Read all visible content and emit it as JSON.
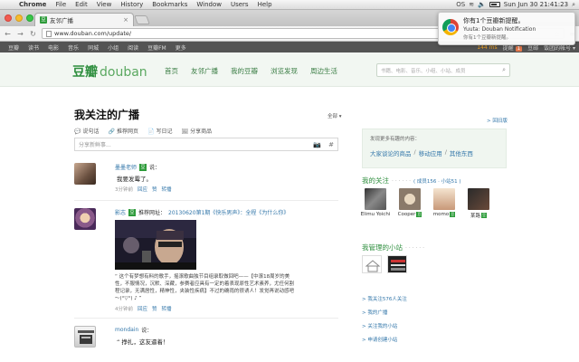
{
  "os_menubar": {
    "app": "Chrome",
    "items": [
      "File",
      "Edit",
      "View",
      "History",
      "Bookmarks",
      "Window",
      "Users",
      "Help"
    ],
    "tray": [
      "OS"
    ],
    "clock": "Sun Jun 30  21:41:23"
  },
  "browser": {
    "tab_title": "友邻广播",
    "tab_favicon": "豆",
    "url": "www.douban.com/update/"
  },
  "notification": {
    "title": "你有1个豆瓣新提醒。",
    "source": "Yuuta: Douban Notification",
    "body": "你有1个豆瓣新提醒。"
  },
  "douban_global_nav": {
    "items": [
      "豆瓣",
      "读书",
      "电影",
      "音乐",
      "同城",
      "小组",
      "阅读",
      "豆瓣FM",
      "更多"
    ],
    "points": "144 ms",
    "reminder_label": "提醒",
    "reminder_count": "1",
    "mail": "豆邮",
    "account": "饭团的帐号 ▾"
  },
  "header": {
    "logo_cn": "豆瓣",
    "logo_en": "douban",
    "nav": [
      "首页",
      "友邻广播",
      "我的豆瓣",
      "浏览发现",
      "周边生活"
    ],
    "search_placeholder": "书籍、电影、音乐、小组、小站、成员"
  },
  "main": {
    "title": "我关注的广播",
    "filter": "全部 ▾",
    "publish": [
      {
        "icon": "💬",
        "label": "说句话"
      },
      {
        "icon": "🔗",
        "label": "推荐网页"
      },
      {
        "icon": "📄",
        "label": "写日记"
      },
      {
        "icon": "🖼",
        "label": "分享商品"
      }
    ],
    "composer_placeholder": "分享新鲜事...",
    "statuses": [
      {
        "user": "墨墨老师",
        "verb": "说：",
        "text": "我要发霉了。",
        "time": "3分钟前",
        "actions": [
          "回应",
          "赞",
          "转播"
        ]
      },
      {
        "user": "影志",
        "verb": "推荐网址：",
        "link": "20130620第1期《快乐男声》：全程《为什么你》",
        "quote": "这个有梦想有料的歌手，摇滚歌曲独节目组录取做回吧——【中滚18周岁的美性，不服情况，沉默、深藏，参赛者应具有一定的着表现原性艺术素养，尤任何割程记录，无满居性，精神性，夹装性疾病】不过的确雨的很诱人！发觉再说动感吧～(°▽°) ♪",
        "time": "4分钟前",
        "actions": [
          "回应",
          "赞",
          "转播"
        ]
      },
      {
        "user": "mondain",
        "verb": "说：",
        "text": "挣扎，这友逼着！"
      }
    ]
  },
  "sidebar": {
    "back_link": "> 回旧版",
    "promo_heading": "发现更多有趣的内容：",
    "promo_links": [
      "大家谈论的商品",
      "移动应用",
      "其他东西"
    ],
    "follows_heading": "我的关注",
    "follows_dots": "· · · · · ·",
    "follows_more": "( 成员156 · 小站51 )",
    "follows": [
      {
        "name": "Elimu Yoichi"
      },
      {
        "name": "Cooper"
      },
      {
        "name": "momo"
      },
      {
        "name": "某路"
      }
    ],
    "sites_heading": "我管理的小站",
    "sites_dots": "· · · · · ·",
    "links": [
      "> 我关注576人关注",
      "> 我的广播",
      "> 关注我的小站",
      "> 申请创建小站"
    ]
  }
}
